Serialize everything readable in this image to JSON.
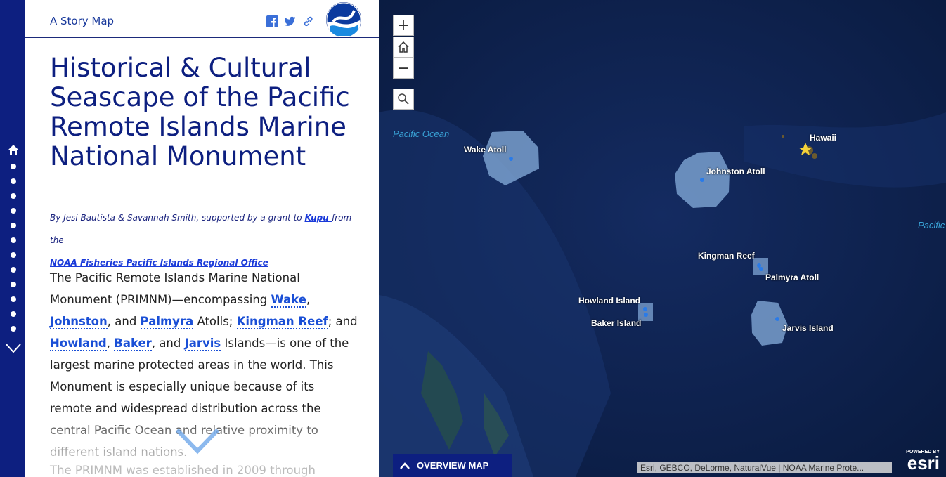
{
  "header": {
    "story_map_label": "A Story Map",
    "logo_text": "NOAA"
  },
  "title": "Historical & Cultural Seascape of the Pacific Remote Islands Marine National Monument",
  "byline": {
    "prefix": "By Jesi Bautista & Savannah Smith, supported by a grant to ",
    "kupu": "Kupu ",
    "mid": "from the",
    "office": "NOAA Fisheries Pacific Islands Regional Office"
  },
  "body": {
    "p1_a": "The Pacific Remote Islands Marine National Monument (PRIMNM)—encompassing ",
    "wake": "Wake",
    "comma1": ", ",
    "johnston": "Johnston",
    "and1": ", and ",
    "palmyra": "Palmyra",
    "atolls": " Atolls; ",
    "kingman": "Kingman Reef",
    "and2": "; and ",
    "howland": "Howland",
    "comma2": ", ",
    "baker": "Baker",
    "and3": ", and ",
    "jarvis": "Jarvis",
    "p1_b": " Islands—is one of the largest marine protected areas in the world. This Monument is especially unique because of its remote and widespread distribution across the central Pacific Ocean and relative proximity to different island nations.",
    "p2": "The PRIMNM was established in 2009 through"
  },
  "map": {
    "zoom_in": "+",
    "zoom_out": "−",
    "ocean_label": "Pacific Ocean",
    "ocean_label_right": "Pacific",
    "labels": {
      "wake": "Wake Atoll",
      "johnston": "Johnston Atoll",
      "hawaii": "Hawaii",
      "kingman": "Kingman Reef",
      "palmyra": "Palmyra Atoll",
      "howland": "Howland Island",
      "baker": "Baker Island",
      "jarvis": "Jarvis Island"
    },
    "overview_button": "OVERVIEW MAP",
    "attribution": "Esri, GEBCO, DeLorme, NaturalVue | NOAA Marine Prote...",
    "powered_by": "POWERED BY",
    "esri": "esri"
  },
  "colors": {
    "nav": "#0d1f80",
    "title": "#0d1f80",
    "link": "#1a4fd6",
    "ocean_deep": "#0e2350",
    "monument_polygon": "#7fa6d4"
  }
}
